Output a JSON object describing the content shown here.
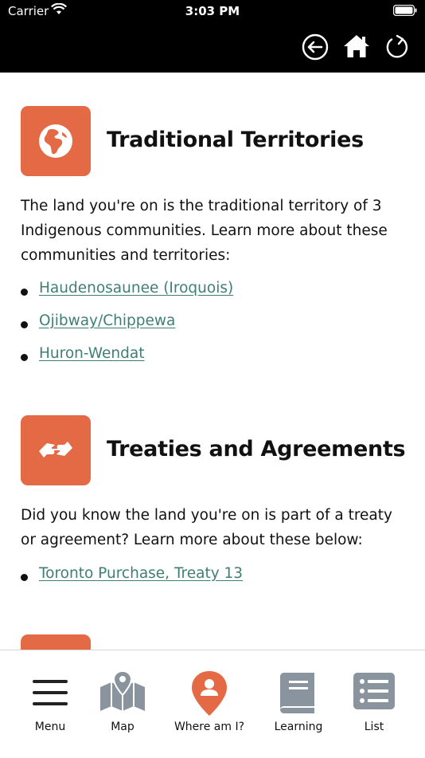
{
  "status_bar": {
    "carrier": "Carrier",
    "time": "3:03 PM"
  },
  "toolbar": {
    "back_icon": "back-circle-arrow-icon",
    "home_icon": "home-icon",
    "refresh_icon": "refresh-icon"
  },
  "sections": [
    {
      "icon": "globe-icon",
      "title": "Traditional Territories",
      "body": "The land you're on is the traditional territory of 3 Indigenous communities. Learn more about these communities and territories:",
      "links": [
        "Haudenosaunee (Iroquois)",
        "Ojibway/Chippewa",
        "Huron-Wendat"
      ]
    },
    {
      "icon": "handshake-icon",
      "title": "Treaties and Agreements",
      "body": "Did you know the land you're on is part of a treaty or agreement? Learn more about these below:",
      "links": [
        "Toronto Purchase, Treaty 13"
      ]
    }
  ],
  "tabs": [
    {
      "label": "Menu",
      "icon": "hamburger-menu-icon"
    },
    {
      "label": "Map",
      "icon": "map-icon"
    },
    {
      "label": "Where am I?",
      "icon": "location-pin-person-icon",
      "active": true
    },
    {
      "label": "Learning",
      "icon": "book-icon"
    },
    {
      "label": "List",
      "icon": "list-icon"
    }
  ],
  "colors": {
    "accent": "#e36a45",
    "link": "#3f7f72",
    "tab_icon": "#8a949e",
    "topbar": "#000000"
  }
}
